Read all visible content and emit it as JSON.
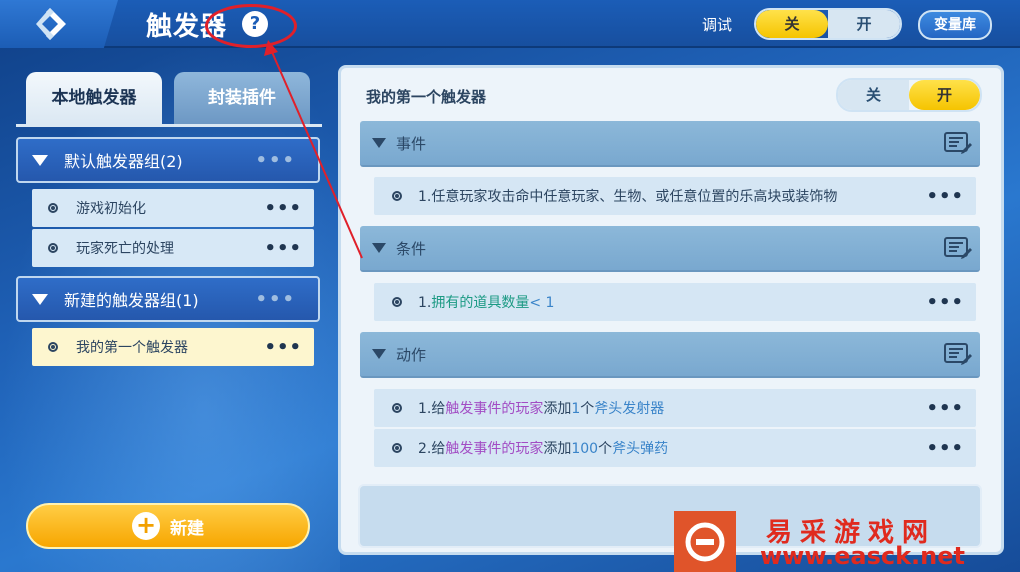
{
  "header": {
    "title": "触发器",
    "help_symbol": "?",
    "debug_label": "调试",
    "debug_toggle": {
      "off_label": "关",
      "on_label": "开",
      "state": "off"
    },
    "variable_library_label": "变量库"
  },
  "sidebar": {
    "tabs": [
      {
        "label": "本地触发器",
        "active": true
      },
      {
        "label": "封装插件",
        "active": false
      }
    ],
    "groups": [
      {
        "label": "默认触发器组(2)",
        "items": [
          {
            "label": "游戏初始化",
            "selected": false
          },
          {
            "label": "玩家死亡的处理",
            "selected": false
          }
        ]
      },
      {
        "label": "新建的触发器组(1)",
        "items": [
          {
            "label": "我的第一个触发器",
            "selected": true
          }
        ]
      }
    ],
    "new_button_label": "新建"
  },
  "trigger": {
    "name": "我的第一个触发器",
    "toggle": {
      "off_label": "关",
      "on_label": "开",
      "state": "on"
    },
    "sections": [
      {
        "label": "事件",
        "rows": [
          {
            "parts": [
              {
                "text": "1.任意玩家攻击命中任意玩家、生物、或任意位置的乐高块或装饰物",
                "color": "default"
              }
            ]
          }
        ]
      },
      {
        "label": "条件",
        "rows": [
          {
            "parts": [
              {
                "text": "1.",
                "color": "default"
              },
              {
                "text": "拥有的道具数量",
                "color": "green"
              },
              {
                "text": "< 1",
                "color": "blue"
              }
            ]
          }
        ]
      },
      {
        "label": "动作",
        "rows": [
          {
            "parts": [
              {
                "text": "1.给",
                "color": "default"
              },
              {
                "text": "触发事件的玩家",
                "color": "purple"
              },
              {
                "text": "添加",
                "color": "default"
              },
              {
                "text": "1",
                "color": "blue"
              },
              {
                "text": "个",
                "color": "default"
              },
              {
                "text": "斧头发射器",
                "color": "blue"
              }
            ]
          },
          {
            "parts": [
              {
                "text": "2.给",
                "color": "default"
              },
              {
                "text": "触发事件的玩家",
                "color": "purple"
              },
              {
                "text": "添加",
                "color": "default"
              },
              {
                "text": "100",
                "color": "blue"
              },
              {
                "text": "个",
                "color": "default"
              },
              {
                "text": "斧头弹药",
                "color": "blue"
              }
            ]
          }
        ]
      }
    ]
  },
  "more_symbol": "•••",
  "watermark": {
    "name": "易采游戏网",
    "url": "www.easck.net"
  },
  "colors": {
    "accent_yellow": "#f5c400",
    "annotation_red": "#e0202a",
    "brand_blue": "#1b5db7"
  }
}
